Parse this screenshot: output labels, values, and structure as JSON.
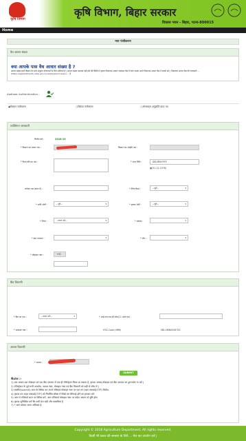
{
  "header": {
    "logo_text": "कृषि विभाग",
    "title": "कृषि विभाग, बिहार सरकार",
    "subtitle": "विकास भवन - बिहार, पटना-800015"
  },
  "nav": {
    "home": "Home"
  },
  "registration": {
    "heading": "नया पंजीकरण",
    "aadhaar_panel_head": "वैध आधार संख्या",
    "aadhaar_question": "क्या आपके पास वैध आधार संख्या है ?",
    "aadhaar_info": "आधार संख्या सभी किसान के सभी अनुदान योजनाओं के लिये अनिवार्य है | आधार संख्या उपलब्ध नहीं होने की स्थिति में कृपया निकटतम आधार नामांकन केंद्र में जाएं अथवा अपने निकटतम आधार केंद्र में संपर्क करें | निकटतम आधार केंद्र की जानकारी ... (https://appointments.uidai.gov.in/centersearch.aspx) ... है",
    "aadhaar_auth_label": "Aadhaar Authentication :",
    "type_options": [
      "किसान पंजीकरण",
      "विक्रेता पंजीकरण",
      "ऑनलाइन अनुज्ञप्ति प्राप्त पत्र"
    ]
  },
  "personal": {
    "head": "व्यक्तिगत जानकारी",
    "year_label": "वित्तीय वर्ष :",
    "year_value": "2018-19",
    "farmer_type_label": "* किसान का प्रकार नाम :",
    "farmer_id_label": "किसान का आईडी नाम :",
    "father_label": "* पिता/पति का नाम :",
    "dob_label": "* जन्म तिथि :",
    "dob_placeholder": "DD-MM-YYYY",
    "dob_hint": "(31-12-1978)",
    "age_label": "वर्तमान उम्र (साल में) :",
    "gender_label": "* लिंग(जेंडर) :",
    "caste_label": "* जाति श्रेणी :",
    "farmer_cat_label": "* कृषक श्रेणी :",
    "district_label": "* जिला :",
    "block_label": "* प्रखण्ड :",
    "panchayat_label": "* ग्राम पंचायत :",
    "village_label": "* गाँव :",
    "mobile_label": "* मोबाइल नंबर :",
    "mobile_prefix": "+91",
    "select_default": "--चुने--",
    "district_default": "--चयन करें--"
  },
  "bank": {
    "head": "बैंक विवरणी",
    "bank_name_label": "* बैंक का नाम :",
    "bank_default": "--चयन करें--",
    "ifsc_label": "* आई.एफ.एस.सी कोड(11 अंको का) :",
    "account_label": "* अकाउंट नंबर :",
    "ifsc_code_label": "IFSC-Code (पंक्ति)",
    "ifsc_value": "SBI-UBIN00087XS"
  },
  "aadhaar": {
    "head": "आधार विवरणी",
    "aadhaar_label": "* आधार :",
    "submit": "SUBMIT",
    "note_title": "Note :-",
    "notes": [
      "1) एक आधार,एक मोबाइल एवं एक बैंक एकाउंट से एक ही रजिस्ट्रेशन किया जा सकता है, कृपया आधार,मोबाइल एवं बैंक एकाउंट का दुरूपयोग ना करें |",
      "2) रजिस्ट्रेशन के पूर्व सभी अपलोड, आधार नंबर, मोबाइल नंबर एवं बैंक विवरणी को सही से जाँच लें |",
      "3) सबमिट(submit) बटन के क्लिक कर अपने रजिस्टर्ड मोबाइल नंबर पर एक वन टाइम पासवर्ड(OTP) मिलेगा.",
      "4) कृपया वन टाइम पासवर्ड(OTP) को निर्धारित बॉक्स में लिखें एवं वेरीफाई होने का इंतजार करें.",
      "5) अगर ये रजिस्टर्ड बटन पर क्लिक करें, अगर रजिस्टर्ड मोबाइल नंबर पर संदेश आएगा तो पुष्टि होगा",
      "6) कृपया सुनिश्चित करें कि सभी डेटा सही और वास्तविक है",
      "7) * वाले कॉलम भरना अनिवार्य है"
    ]
  },
  "footer": {
    "copyright": "Copyright © 2018 Agriculture Department, All rights reserved.",
    "help": "किसी भी प्रकार की समस्या के लिये ... मेल कर उपयोग करें |"
  },
  "colors": {
    "header_green": "#7ec322",
    "footer_green": "#7cba2c",
    "nav_black": "#1d1d1d",
    "accent_blue": "#1a3f9c"
  }
}
